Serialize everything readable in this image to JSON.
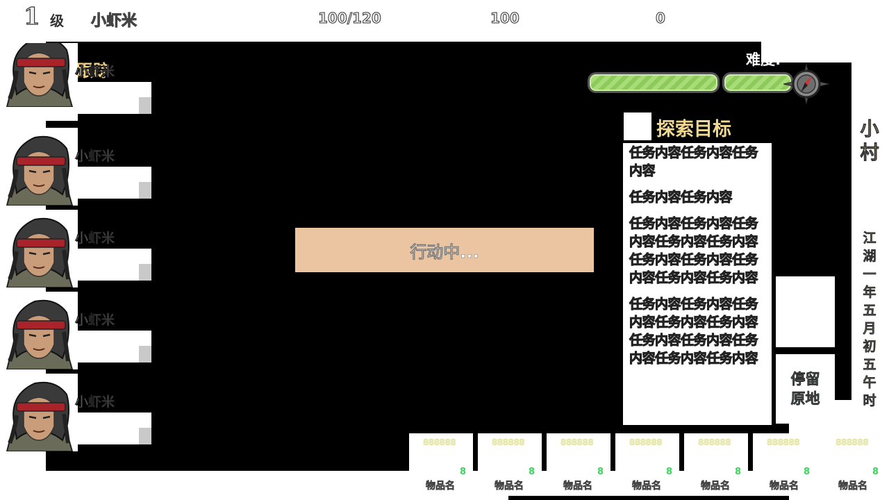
{
  "top_bar": {
    "level_value": "1",
    "level_label": "级",
    "player_name": "小虾米",
    "hp": "100/120",
    "stat_two": "100",
    "stat_three": "0"
  },
  "track": {
    "title": "跟踪",
    "members": [
      {
        "name": "小虾米"
      },
      {
        "name": "小虾米"
      },
      {
        "name": "小虾米"
      },
      {
        "name": "小虾米"
      },
      {
        "name": "小虾米"
      }
    ]
  },
  "difficulty": {
    "label": "难度:"
  },
  "action": {
    "status": "行动中..."
  },
  "explore": {
    "title": "探索目标",
    "tasks": [
      "任务内容任务内容任务内容",
      "任务内容任务内容",
      "任务内容任务内容任务内容任务内容任务内容任务内容任务内容任务内容任务内容任务内容",
      "任务内容任务内容任务内容任务内容任务内容任务内容任务内容任务内容任务内容任务内容"
    ]
  },
  "location": {
    "name": "小村",
    "date": "江湖一年五月初五午时"
  },
  "stay_button": {
    "label": "停留原地"
  },
  "inventory": [
    {
      "count": "888888",
      "qty": "8",
      "name": "物品名"
    },
    {
      "count": "888888",
      "qty": "8",
      "name": "物品名"
    },
    {
      "count": "888888",
      "qty": "8",
      "name": "物品名"
    },
    {
      "count": "888888",
      "qty": "8",
      "name": "物品名"
    },
    {
      "count": "888888",
      "qty": "8",
      "name": "物品名"
    },
    {
      "count": "888888",
      "qty": "8",
      "name": "物品名"
    },
    {
      "count": "888888",
      "qty": "8",
      "name": "物品名"
    }
  ],
  "colors": {
    "map_bg": "#000000",
    "action_bg": "#ebc4a2",
    "difficulty_fill": "#9bd36b",
    "stay_text": "#5fc9c9"
  }
}
